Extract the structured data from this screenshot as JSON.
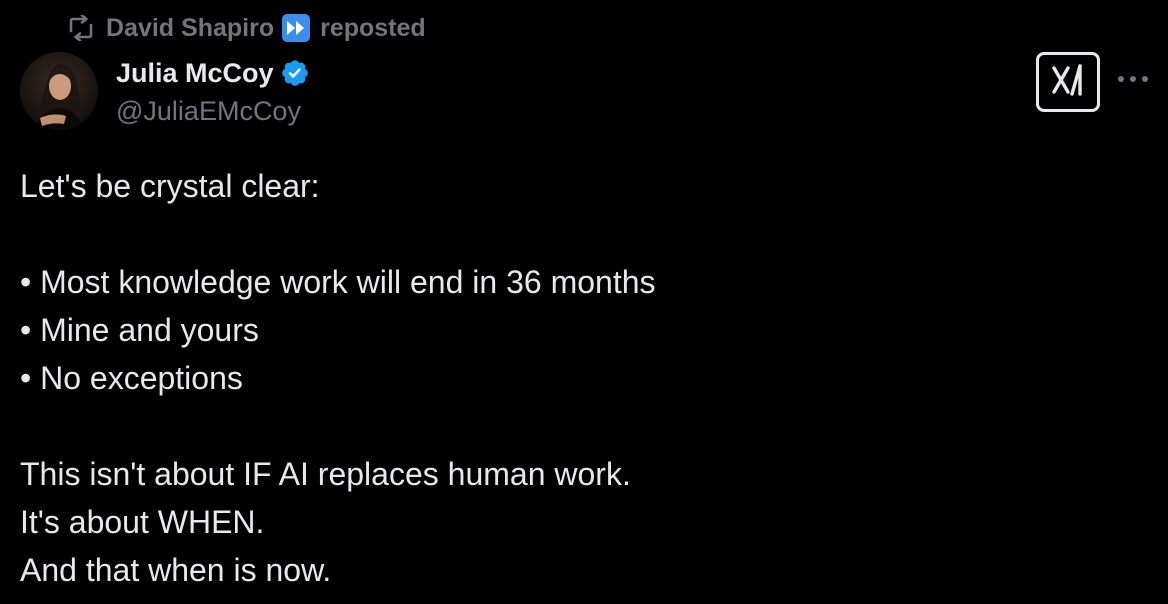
{
  "repost": {
    "icon": "repost-icon",
    "reposter_name": "David Shapiro",
    "reposter_emoji": "fast-forward-icon",
    "label": "reposted"
  },
  "author": {
    "display_name": "Julia McCoy",
    "handle": "@JuliaEMcCoy",
    "verified": true,
    "verified_color": "#1d9bf0"
  },
  "actions": {
    "grok_icon": "grok-icon",
    "more_icon": "more-options-icon"
  },
  "tweet": {
    "intro": "Let's be crystal clear:",
    "bullets": [
      "• Most knowledge work will end in 36 months",
      "• Mine and yours",
      "• No exceptions"
    ],
    "closing": [
      "This isn't about IF AI replaces human work.",
      "It's about WHEN.",
      "And that when is now."
    ]
  },
  "colors": {
    "background": "#000000",
    "primary_text": "#e7e9ea",
    "secondary_text": "#71767b",
    "accent_blue": "#1d9bf0"
  }
}
